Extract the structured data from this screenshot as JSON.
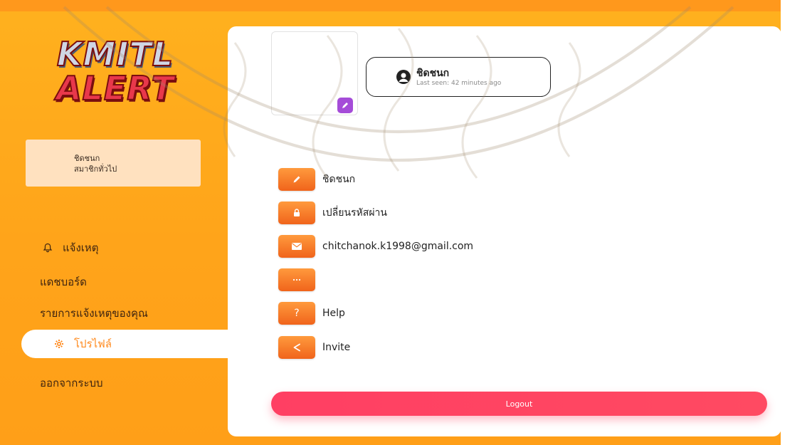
{
  "app": {
    "logo_line1": "KMITL",
    "logo_line2": "ALERT"
  },
  "user_card": {
    "name": "ชิดชนก",
    "role": "สมาชิกทั่วไป"
  },
  "nav": {
    "items": [
      {
        "label": "แจ้งเหตุ",
        "icon": "bell-icon"
      },
      {
        "label": "แดชบอร์ด"
      },
      {
        "label": "รายการแจ้งเหตุของคุณ"
      },
      {
        "label": "โปรไฟล์",
        "icon": "gear-icon",
        "active": true
      },
      {
        "label": "ออกจากระบบ"
      }
    ]
  },
  "profile": {
    "name": "ชิดชนก",
    "last_seen": "Last seen: 42 minutes ago"
  },
  "settings": {
    "rows": [
      {
        "label": "ชิดชนก",
        "icon": "pencil-icon"
      },
      {
        "label": "เปลี่ยนรหัสผ่าน",
        "icon": "lock-icon"
      },
      {
        "label": "chitchanok.k1998@gmail.com",
        "icon": "mail-icon"
      },
      {
        "label": "",
        "icon": "more-icon"
      },
      {
        "label": "Help",
        "icon": "question-icon"
      },
      {
        "label": "Invite",
        "icon": "share-icon"
      }
    ]
  },
  "logout_label": "Logout",
  "colors": {
    "sidebar_orange": "#ffa41a",
    "tile_orange": "#f0641b",
    "logout_pink": "#ff3f63",
    "edit_purple": "#a54cd8"
  }
}
